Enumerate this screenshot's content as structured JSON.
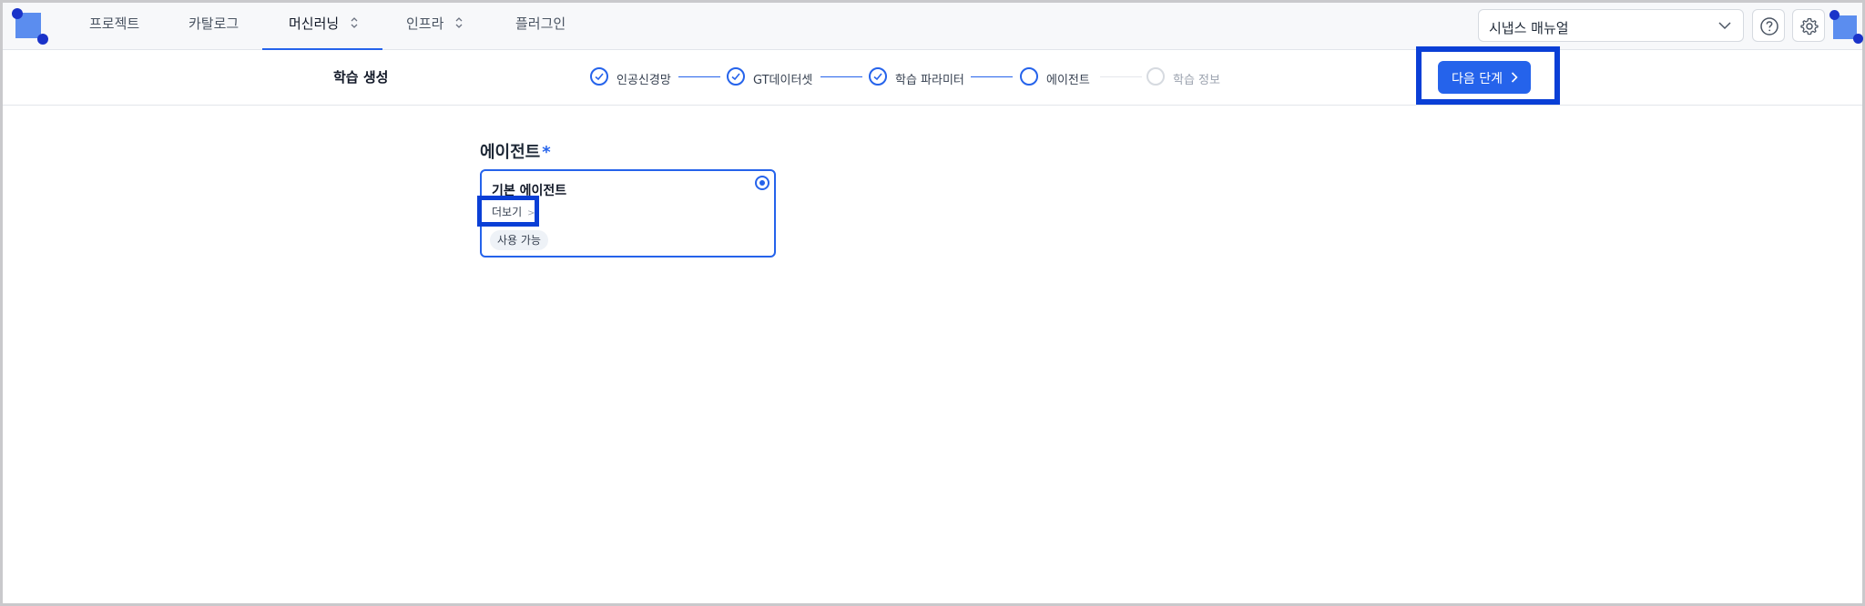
{
  "nav": {
    "items": [
      {
        "label": "프로젝트"
      },
      {
        "label": "카탈로그"
      },
      {
        "label": "머신러닝"
      },
      {
        "label": "인프라"
      },
      {
        "label": "플러그인"
      }
    ],
    "active_item": "머신러닝",
    "manual_select": {
      "value": "시냅스 매뉴얼"
    },
    "icons": [
      "help-icon",
      "gear-icon"
    ]
  },
  "stepbar": {
    "title": "학습 생성",
    "steps": [
      {
        "label": "인공신경망",
        "status": "done"
      },
      {
        "label": "GT데이터셋",
        "status": "done"
      },
      {
        "label": "학습 파라미터",
        "status": "done"
      },
      {
        "label": "에이전트",
        "status": "current"
      },
      {
        "label": "학습 정보",
        "status": "pending"
      }
    ],
    "next_button": "다음 단계"
  },
  "main": {
    "section_label": "에이전트",
    "required_mark": "*",
    "agent_card": {
      "name": "기본 에이전트",
      "more_link": "더보기",
      "status_badge": "사용 가능",
      "selected": true
    }
  },
  "colors": {
    "accent": "#2563eb",
    "highlight_box": "#0a3fd6",
    "logo": "#5b8def"
  }
}
